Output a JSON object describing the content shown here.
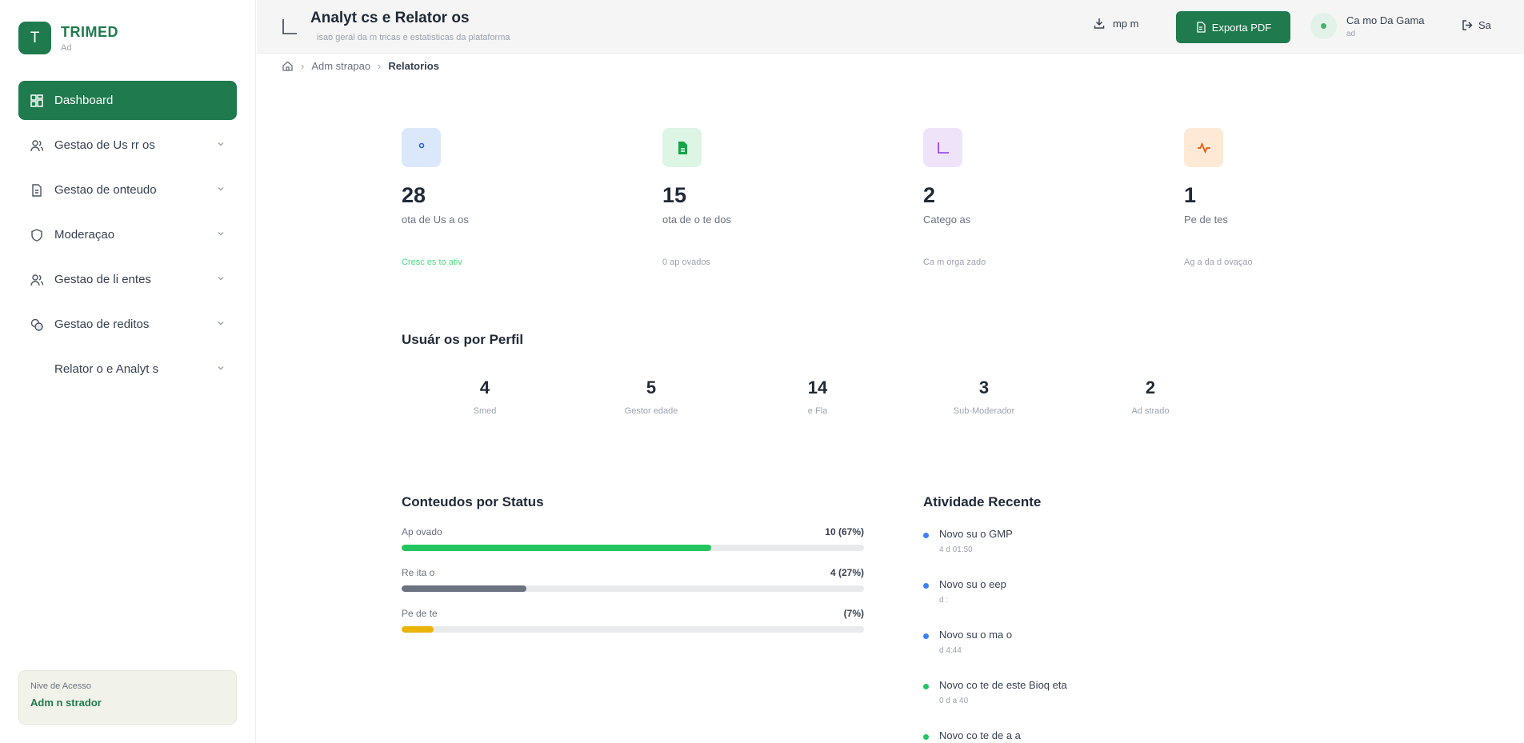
{
  "brand": {
    "logo_letter": "T",
    "name": "TRIMED",
    "sub": "Ad"
  },
  "sidebar": {
    "items": [
      {
        "label": "Dashboard",
        "icon": "dashboard-icon",
        "active": true
      },
      {
        "label": "Gestao de Us  rr os",
        "icon": "users-icon",
        "active": false
      },
      {
        "label": "Gestao de   onteudo",
        "icon": "document-icon",
        "active": false
      },
      {
        "label": "Moderaçao",
        "icon": "shield-icon",
        "active": false
      },
      {
        "label": "Gestao de  li entes",
        "icon": "clients-icon",
        "active": false
      },
      {
        "label": "Gestao de   reditos",
        "icon": "coins-icon",
        "active": false
      },
      {
        "label": "Relator o  e Analyt  s",
        "icon": "chart-icon",
        "active": false
      }
    ],
    "access": {
      "label": "Nive  de Acesso",
      "value": "Adm n strador"
    }
  },
  "header": {
    "title": "Analyt cs e Relator os",
    "subtitle": "isao geral da  m  tricas  e estatisticas da plataforma",
    "import_label": "mp  m",
    "export_label": "Exporta  PDF",
    "user_name": "Ca mo Da Gama",
    "user_role": "ad",
    "logout_label": "Sa"
  },
  "breadcrumb": {
    "section": "Adm    strapao",
    "current": "Relatorios"
  },
  "colors": {
    "brand": "#1f7a4d",
    "approved": "#22c55e",
    "rejected": "#6b7280",
    "pending": "#eab308",
    "dot_blue": "#3b82f6",
    "dot_green": "#22c55e"
  },
  "stats": [
    {
      "value": "28",
      "label": " ota  de Us  a  os",
      "foot": "Cresc  es to  ativ",
      "icon": "users-icon"
    },
    {
      "value": "15",
      "label": " ota  de   o te  dos",
      "foot": "0 ap ovados",
      "icon": "file-icon"
    },
    {
      "value": "2",
      "label": "Catego  as",
      "foot": "Ca  m orga  zado",
      "icon": "category-icon"
    },
    {
      "value": "1",
      "label": "Pe  de  tes",
      "foot": "Ag a da  d   ovaçao",
      "icon": "activity-icon"
    }
  ],
  "profiles": {
    "title": "Usuár os por Perfil",
    "items": [
      {
        "value": "4",
        "label": "Smed"
      },
      {
        "value": "5",
        "label": "Gestor   edade"
      },
      {
        "value": "14",
        "label": "  e Fla"
      },
      {
        "value": "3",
        "label": "Sub-Moderador"
      },
      {
        "value": "2",
        "label": "Ad    strado"
      }
    ]
  },
  "content_status": {
    "title": "Conteudos por Status",
    "items": [
      {
        "label": "Ap ovado",
        "count": "10 (67%)",
        "fraction": 0.67,
        "color": "#22c55e"
      },
      {
        "label": "Re  ita  o",
        "count": "4 (27%)",
        "fraction": 0.27,
        "color": "#6b7280"
      },
      {
        "label": "Pe  de  te",
        "count": "(7%)",
        "fraction": 0.07,
        "color": "#eab308"
      }
    ]
  },
  "activity": {
    "title": "Atividade Recente",
    "items": [
      {
        "title": "Novo   su  o  GMP",
        "time": "  4 d      01:50",
        "dot": "#3b82f6"
      },
      {
        "title": "Novo   su  o  eep",
        "time": "  d         :",
        "dot": "#3b82f6"
      },
      {
        "title": "Novo   su  o  ma  o",
        "time": "  d        4:44",
        "dot": "#3b82f6"
      },
      {
        "title": "Novo co  te  de   este Bioq  eta",
        "time": "  0 d  a        40",
        "dot": "#22c55e"
      },
      {
        "title": "Novo co  te  de   a  a",
        "time": "",
        "dot": "#22c55e"
      }
    ]
  }
}
